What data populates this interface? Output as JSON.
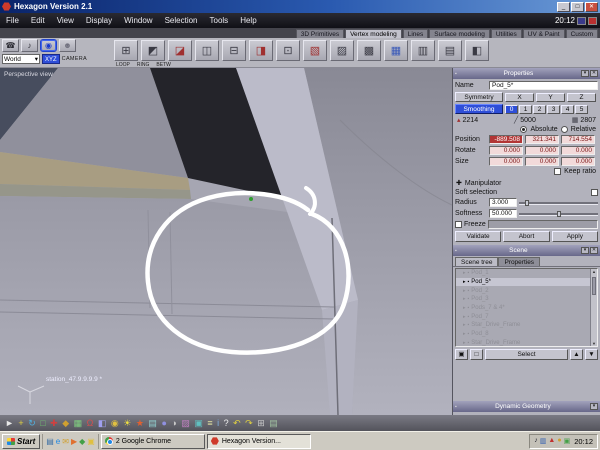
{
  "window": {
    "title": "Hexagon Version 2.1",
    "menu_items": [
      "File",
      "Edit",
      "View",
      "Display",
      "Window",
      "Selection",
      "Tools",
      "Help"
    ],
    "menu_time": "20:12"
  },
  "tabs": [
    {
      "label": "3D Primitives",
      "active": false
    },
    {
      "label": "Vertex modeling",
      "active": true
    },
    {
      "label": "Lines",
      "active": false
    },
    {
      "label": "Surface modeling",
      "active": false
    },
    {
      "label": "Utilities",
      "active": false
    },
    {
      "label": "UV & Paint",
      "active": false
    },
    {
      "label": "Custom",
      "active": false
    }
  ],
  "toolbar": {
    "quick_icons": [
      {
        "name": "phone-icon",
        "glyph": "☎",
        "color": "#2a2a32",
        "active": false
      },
      {
        "name": "speaker-icon",
        "glyph": "♪",
        "color": "#2a2a32",
        "active": false
      },
      {
        "name": "eye-icon",
        "glyph": "◉",
        "color": "#1a3acc",
        "active": true
      },
      {
        "name": "ghost-icon",
        "glyph": "☻",
        "color": "#70707e",
        "active": false
      }
    ],
    "world_label": "World",
    "xyz_label": "XYZ",
    "camera_label": "CAMERA",
    "sub_labels": [
      "LOOP",
      "RING",
      "BETW"
    ],
    "tools": [
      {
        "name": "tessellate-tool-icon",
        "glyph": "⊞",
        "color": "#3a3a44"
      },
      {
        "name": "extrude-surface-tool-icon",
        "glyph": "◩",
        "color": "#3a3a44"
      },
      {
        "name": "extrude-edge-tool-icon",
        "glyph": "◪",
        "color": "#a03030"
      },
      {
        "name": "sweep-tool-icon",
        "glyph": "◫",
        "color": "#3a3a44"
      },
      {
        "name": "bridge-tool-icon",
        "glyph": "⊟",
        "color": "#3a3a44"
      },
      {
        "name": "extract-tool-icon",
        "glyph": "◨",
        "color": "#a03030"
      },
      {
        "name": "weld-points-tool-icon",
        "glyph": "⊡",
        "color": "#3a3a44"
      },
      {
        "name": "cut-slice-tool-icon",
        "glyph": "▧",
        "color": "#a03030"
      },
      {
        "name": "dissolve-tool-icon",
        "glyph": "▨",
        "color": "#3a3a44"
      },
      {
        "name": "decimate-tool-icon",
        "glyph": "▩",
        "color": "#3a3a44"
      },
      {
        "name": "smooth-tool-icon",
        "glyph": "▦",
        "color": "#3858b8"
      },
      {
        "name": "pinch-tool-icon",
        "glyph": "▥",
        "color": "#3a3a44"
      },
      {
        "name": "inflate-tool-icon",
        "glyph": "▤",
        "color": "#3a3a44"
      },
      {
        "name": "symmetry-tool-icon",
        "glyph": "◧",
        "color": "#3a3a44"
      }
    ]
  },
  "viewport": {
    "view_label": "Perspective view",
    "station_label": "station_47.9.9.9.9 *"
  },
  "properties": {
    "header": "Properties",
    "name_label": "Name",
    "name_value": "Pod_5*",
    "symmetry_label": "Symmetry",
    "axes": [
      "X",
      "Y",
      "Z"
    ],
    "smoothing_label": "Smoothing",
    "smoothing_levels": [
      {
        "label": "0",
        "active": true
      },
      {
        "label": "1",
        "active": false
      },
      {
        "label": "2",
        "active": false
      },
      {
        "label": "3",
        "active": false
      },
      {
        "label": "4",
        "active": false
      },
      {
        "label": "5",
        "active": false
      }
    ],
    "counts": [
      {
        "name": "points-count",
        "icon": "points-count-icon",
        "glyph": "▴",
        "color": "#a03030",
        "value": "2214"
      },
      {
        "name": "edges-count",
        "icon": "edges-count-icon",
        "glyph": "╱",
        "color": "#3a3a44",
        "value": "5000"
      },
      {
        "name": "faces-count",
        "icon": "faces-count-icon",
        "glyph": "▦",
        "color": "#3a3a44",
        "value": "2807"
      }
    ],
    "absolute_label": "Absolute",
    "relative_label": "Relative",
    "absolute_selected": true,
    "position_label": "Position",
    "position_values": [
      {
        "value": "-889.508",
        "selected": true
      },
      {
        "value": "321.341",
        "selected": false
      },
      {
        "value": "714.554",
        "selected": false
      }
    ],
    "rotate_label": "Rotate",
    "rotate_values": [
      "0.000",
      "0.000",
      "0.000"
    ],
    "size_label": "Size",
    "size_values": [
      "0.000",
      "0.000",
      "0.000"
    ],
    "keep_ratio_label": "Keep ratio",
    "manipulator_label": "Manipulator",
    "soft_selection_label": "Soft selection",
    "radius_label": "Radius",
    "radius_value": "3.000",
    "radius_slider_pos": "8%",
    "softness_label": "Softness",
    "softness_value": "50.000",
    "softness_slider_pos": "48%",
    "freeze_label": "Freeze",
    "validate_label": "Validate",
    "abort_label": "Abort",
    "apply_label": "Apply"
  },
  "scene": {
    "header": "Scene",
    "tabs": [
      {
        "label": "Scene tree",
        "active": true
      },
      {
        "label": "Properties",
        "active": false
      }
    ],
    "items": [
      {
        "label": "Pod_1",
        "selected": false
      },
      {
        "label": "Pod_5*",
        "selected": true
      },
      {
        "label": "Pod_2",
        "selected": false
      },
      {
        "label": "Pod_3",
        "selected": false
      },
      {
        "label": "Pods_7 & 4*",
        "selected": false
      },
      {
        "label": "Pod_7",
        "selected": false
      },
      {
        "label": "Star_Drive_Frame",
        "selected": false
      },
      {
        "label": "Pod_8",
        "selected": false
      },
      {
        "label": "Star_Drive_Frame",
        "selected": false
      }
    ],
    "select_label": "Select"
  },
  "dynamic_geometry": {
    "header": "Dynamic Geometry"
  },
  "bottom_strip": {
    "icons": [
      {
        "name": "select-arrow-icon",
        "glyph": "►",
        "color": "#e8e8e8"
      },
      {
        "name": "move-tool-icon",
        "glyph": "+",
        "color": "#e0d040"
      },
      {
        "name": "rotate-tool-icon",
        "glyph": "↻",
        "color": "#50b0e0"
      },
      {
        "name": "scale-tool-icon",
        "glyph": "□",
        "color": "#70c070"
      },
      {
        "name": "universal-manip-icon",
        "glyph": "✚",
        "color": "#d04040"
      },
      {
        "name": "snap-icon",
        "glyph": "◆",
        "color": "#d0a030"
      },
      {
        "name": "grid-icon",
        "glyph": "▦",
        "color": "#80d080"
      },
      {
        "name": "magnet-icon",
        "glyph": "Ω",
        "color": "#d05050"
      },
      {
        "name": "symmetry-icon",
        "glyph": "◧",
        "color": "#a0a0f0"
      },
      {
        "name": "camera-icon",
        "glyph": "◉",
        "color": "#e0c040"
      },
      {
        "name": "light-icon",
        "glyph": "☀",
        "color": "#f0e040"
      },
      {
        "name": "render-icon",
        "glyph": "★",
        "color": "#e06030"
      },
      {
        "name": "wireframe-icon",
        "glyph": "▤",
        "color": "#90d0d0"
      },
      {
        "name": "shaded-icon",
        "glyph": "●",
        "color": "#9090e0"
      },
      {
        "name": "smooth-shade-icon",
        "glyph": "◑",
        "color": "#c8c8c8"
      },
      {
        "name": "texture-icon",
        "glyph": "▨",
        "color": "#c080c0"
      },
      {
        "name": "background-icon",
        "glyph": "▣",
        "color": "#60c0c0"
      },
      {
        "name": "ruler-icon",
        "glyph": "≡",
        "color": "#e0e0a0"
      },
      {
        "name": "info-icon",
        "glyph": "i",
        "color": "#80b0e0"
      },
      {
        "name": "help-icon",
        "glyph": "?",
        "color": "#f0f0f0"
      },
      {
        "name": "undo-icon",
        "glyph": "↶",
        "color": "#e0d040"
      },
      {
        "name": "redo-icon",
        "glyph": "↷",
        "color": "#e0d040"
      },
      {
        "name": "fullscreen-icon",
        "glyph": "⊞",
        "color": "#c8c8c8"
      },
      {
        "name": "properties-icon",
        "glyph": "▤",
        "color": "#a0c0a0"
      }
    ]
  },
  "taskbar": {
    "start_label": "Start",
    "quick_launch": [
      {
        "name": "show-desktop-icon",
        "glyph": "▤",
        "color": "#3a6ea5"
      },
      {
        "name": "ie-icon",
        "glyph": "e",
        "color": "#1e88e5"
      },
      {
        "name": "outlook-icon",
        "glyph": "✉",
        "color": "#d0a030"
      },
      {
        "name": "media-player-icon",
        "glyph": "▶",
        "color": "#e07030"
      },
      {
        "name": "messenger-icon",
        "glyph": "◆",
        "color": "#43a047"
      },
      {
        "name": "explorer-icon",
        "glyph": "▣",
        "color": "#e0c040"
      }
    ],
    "tasks": [
      {
        "label": "2 Google Chrome",
        "icon": "chrome-icon",
        "active": false
      },
      {
        "label": "Hexagon Version...",
        "icon": "hexagon-icon",
        "active": true
      }
    ],
    "tray_icons": [
      {
        "name": "volume-icon",
        "glyph": "♪",
        "color": "#2a2a32"
      },
      {
        "name": "network-icon",
        "glyph": "▥",
        "color": "#2a5ab0"
      },
      {
        "name": "antivirus-icon",
        "glyph": "▲",
        "color": "#c03030"
      },
      {
        "name": "update-icon",
        "glyph": "●",
        "color": "#d0a030"
      },
      {
        "name": "display-icon",
        "glyph": "▣",
        "color": "#43a047"
      }
    ],
    "time": "20:12"
  }
}
